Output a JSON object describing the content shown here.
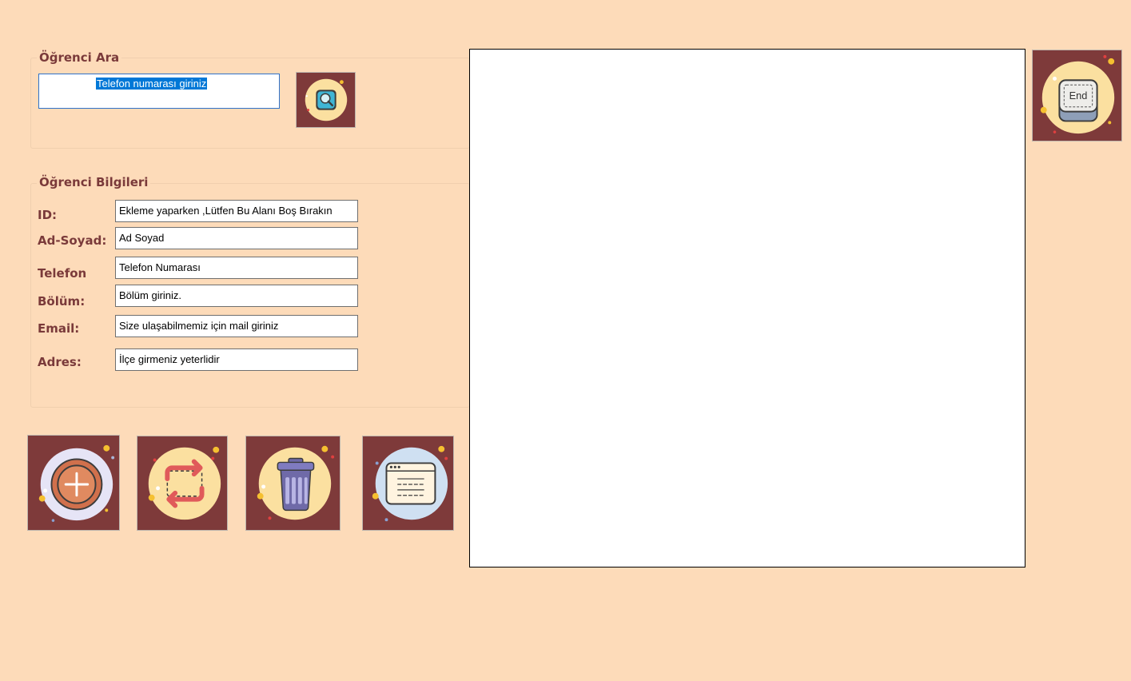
{
  "search_group": {
    "title": "Öğrenci Ara",
    "input_value": "Telefon numarası giriniz"
  },
  "info_group": {
    "title": "Öğrenci Bilgileri",
    "labels": {
      "id": "ID:",
      "name": "Ad-Soyad:",
      "phone": "Telefon",
      "dept": "Bölüm:",
      "email": "Email:",
      "address": "Adres:"
    },
    "fields": {
      "id": "Ekleme yaparken ,Lütfen Bu Alanı Boş Bırakın",
      "name": "Ad Soyad",
      "phone": "Telefon Numarası",
      "dept": "Bölüm giriniz.",
      "email": "Size ulaşabilmemiz için mail giriniz",
      "address": "İlçe girmeniz yeterlidir"
    }
  },
  "end_button": {
    "label": "End"
  },
  "colors": {
    "background": "#FDDBB9",
    "label": "#7A3A3A",
    "button_bg": "#7E3A3A",
    "circle_yellow": "#FBE0A0",
    "circle_lavender": "#E6E4F6",
    "circle_blue": "#CFE0F2"
  },
  "icons": [
    "search-icon",
    "end-key-icon",
    "add-icon",
    "update-icon",
    "delete-icon",
    "list-icon"
  ]
}
